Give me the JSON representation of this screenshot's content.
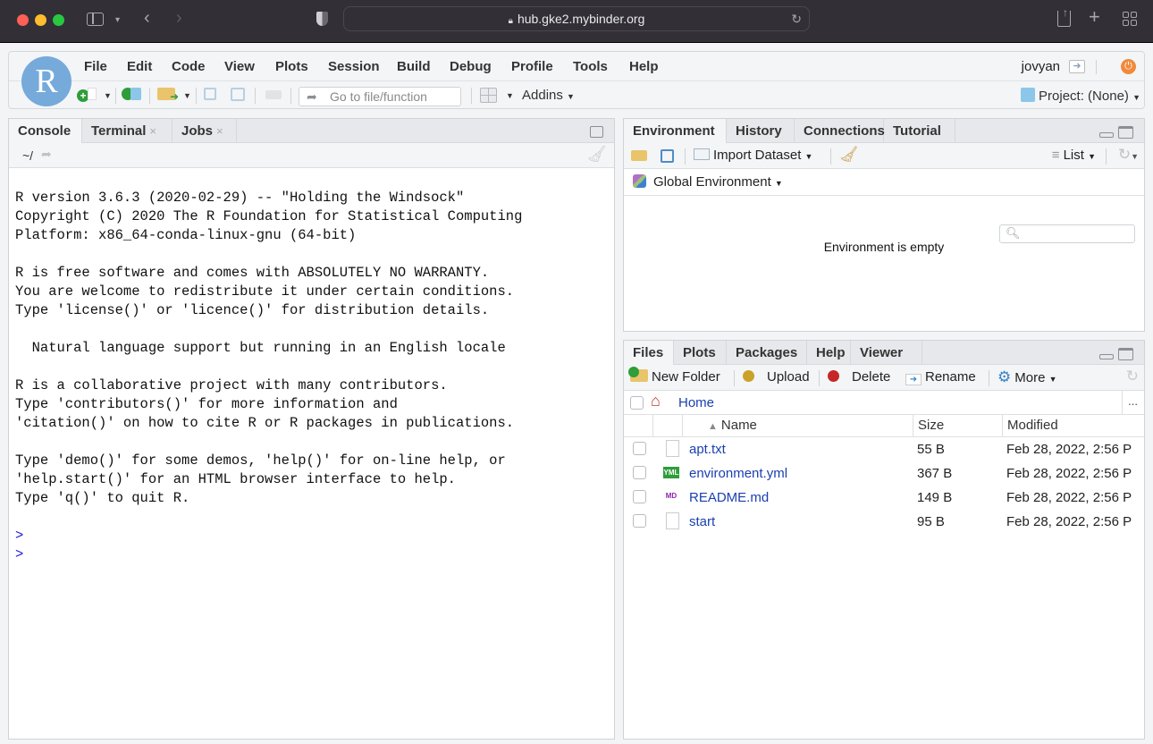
{
  "browser": {
    "url": "hub.gke2.mybinder.org",
    "icons": [
      "sidebar-icon",
      "chevron-down-icon",
      "back-icon",
      "forward-icon",
      "shield-icon",
      "lock-icon",
      "reload-icon",
      "share-icon",
      "new-tab-icon",
      "tab-overview-icon"
    ]
  },
  "rstudio": {
    "logo": "R",
    "menu": [
      "File",
      "Edit",
      "Code",
      "View",
      "Plots",
      "Session",
      "Build",
      "Debug",
      "Profile",
      "Tools",
      "Help"
    ],
    "user": "jovyan",
    "goto_placeholder": "Go to file/function",
    "addins_label": "Addins",
    "project_label": "Project: (None)"
  },
  "console_pane": {
    "tabs": [
      {
        "label": "Console",
        "closable": false,
        "active": true
      },
      {
        "label": "Terminal",
        "closable": true
      },
      {
        "label": "Jobs",
        "closable": true
      }
    ],
    "working_dir": "~/",
    "close_glyph": "×",
    "lines": [
      "R version 3.6.3 (2020-02-29) -- \"Holding the Windsock\"",
      "Copyright (C) 2020 The R Foundation for Statistical Computing",
      "Platform: x86_64-conda-linux-gnu (64-bit)",
      "",
      "R is free software and comes with ABSOLUTELY NO WARRANTY.",
      "You are welcome to redistribute it under certain conditions.",
      "Type 'license()' or 'licence()' for distribution details.",
      "",
      "  Natural language support but running in an English locale",
      "",
      "R is a collaborative project with many contributors.",
      "Type 'contributors()' for more information and",
      "'citation()' on how to cite R or R packages in publications.",
      "",
      "Type 'demo()' for some demos, 'help()' for on-line help, or",
      "'help.start()' for an HTML browser interface to help.",
      "Type 'q()' to quit R.",
      ""
    ],
    "prompts": [
      ">",
      ">"
    ]
  },
  "env_pane": {
    "tabs": [
      {
        "label": "Environment",
        "active": true
      },
      {
        "label": "History"
      },
      {
        "label": "Connections"
      },
      {
        "label": "Tutorial"
      }
    ],
    "import_label": "Import Dataset",
    "view_mode": "List",
    "scope": "Global Environment",
    "search_placeholder": "",
    "empty_message": "Environment is empty"
  },
  "files_pane": {
    "tabs": [
      {
        "label": "Files",
        "active": true
      },
      {
        "label": "Plots"
      },
      {
        "label": "Packages"
      },
      {
        "label": "Help"
      },
      {
        "label": "Viewer"
      }
    ],
    "toolbar": {
      "new_folder": "New Folder",
      "upload": "Upload",
      "delete": "Delete",
      "rename": "Rename",
      "more": "More"
    },
    "breadcrumb": "Home",
    "more_glyph": "...",
    "columns": {
      "name": "Name",
      "size": "Size",
      "modified": "Modified"
    },
    "sort_glyph": "▲",
    "files": [
      {
        "name": "apt.txt",
        "size": "55 B",
        "modified": "Feb 28, 2022, 2:56 P",
        "type": "text",
        "badge": ""
      },
      {
        "name": "environment.yml",
        "size": "367 B",
        "modified": "Feb 28, 2022, 2:56 P",
        "type": "yml",
        "badge": "YML"
      },
      {
        "name": "README.md",
        "size": "149 B",
        "modified": "Feb 28, 2022, 2:56 P",
        "type": "md",
        "badge": "MD"
      },
      {
        "name": "start",
        "size": "95 B",
        "modified": "Feb 28, 2022, 2:56 P",
        "type": "text",
        "badge": ""
      }
    ]
  },
  "colors": {
    "r_blue": "#75aadb",
    "link": "#1a3fb0",
    "prompt": "#1d1dd6",
    "power": "#f08a3c"
  }
}
